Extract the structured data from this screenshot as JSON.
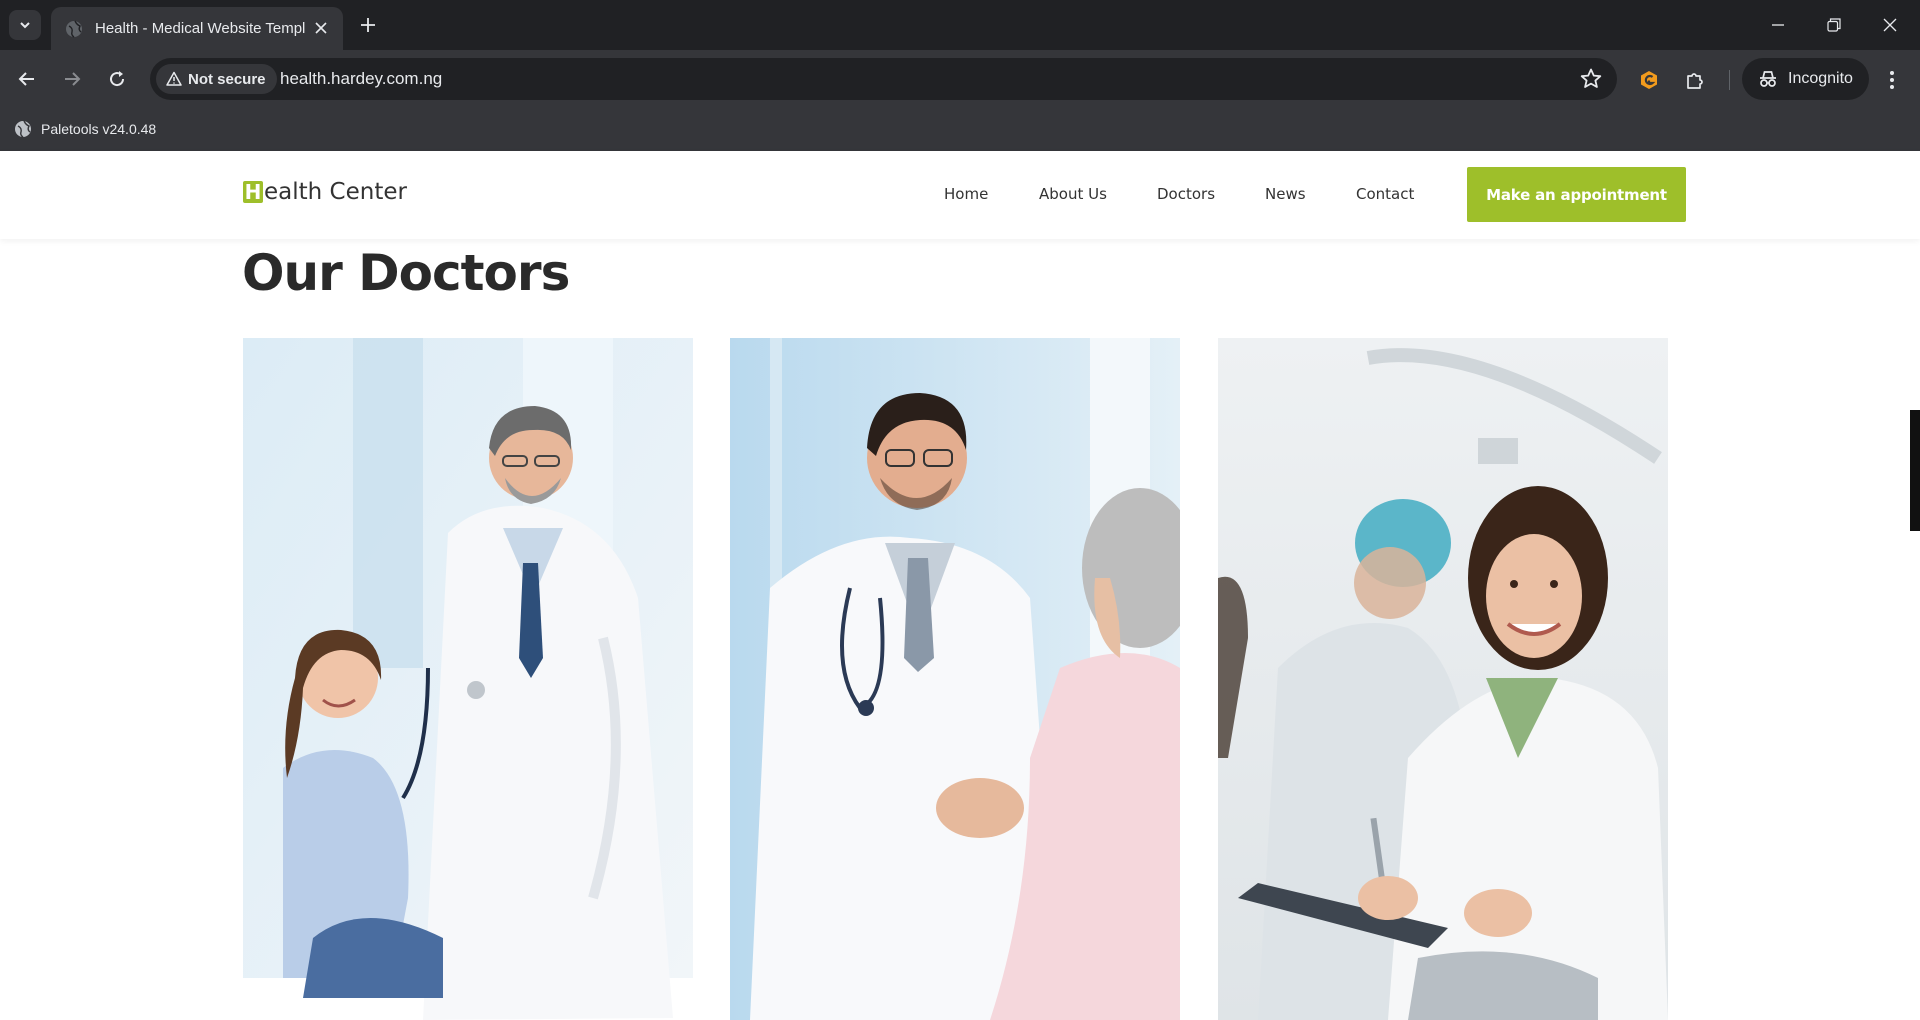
{
  "browser": {
    "tab_title": "Health - Medical Website Template",
    "security_label": "Not secure",
    "url": "health.hardey.com.ng",
    "incognito_label": "Incognito",
    "bookmark_label": "Paletools v24.0.48"
  },
  "site": {
    "logo_letter": "H",
    "logo_rest": "ealth Center",
    "nav": [
      {
        "label": "Home"
      },
      {
        "label": "About Us"
      },
      {
        "label": "Doctors"
      },
      {
        "label": "News"
      },
      {
        "label": "Contact"
      }
    ],
    "cta_label": "Make an appointment",
    "accent_color": "#9ebf2a"
  },
  "doctors": {
    "title": "Our Doctors",
    "cards": [
      {
        "image": "doctor-with-child-photo"
      },
      {
        "image": "doctor-with-elderly-patient-photo"
      },
      {
        "image": "female-doctor-with-clipboard-photo"
      }
    ]
  }
}
